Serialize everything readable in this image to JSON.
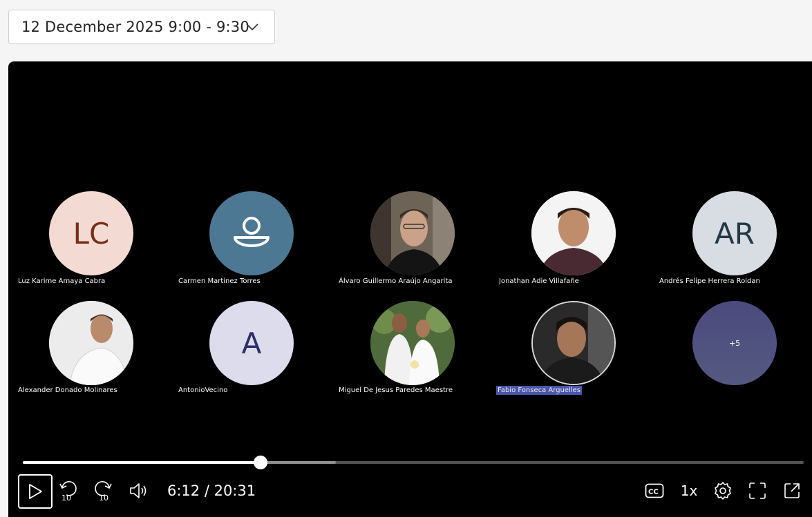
{
  "meeting_select": {
    "label": "12 December 2025 9:00 - 9:30",
    "icon": "chevron-down-icon"
  },
  "participants": [
    {
      "name": "Luz Karime Amaya Cabra",
      "type": "initials",
      "initials": "LC",
      "bg": "#f3dbd3",
      "fg": "#7a2f16"
    },
    {
      "name": "Carmen Martinez Torres",
      "type": "icon",
      "icon": "person-icon",
      "bg": "#4c7894",
      "fg": "#ffffff"
    },
    {
      "name": "Álvaro Guillermo Araújo Angarita",
      "type": "photo",
      "bg": "#5d5348"
    },
    {
      "name": "Jonathan Adie Villafañe",
      "type": "photo",
      "bg": "#f2f2f2"
    },
    {
      "name": "Andrés Felipe Herrera Roldan",
      "type": "initials",
      "initials": "AR",
      "bg": "#d7dde2",
      "fg": "#24384a"
    },
    {
      "name": "Alexander Donado Molinares",
      "type": "photo",
      "bg": "#efefef"
    },
    {
      "name": "AntonioVecino",
      "type": "initials",
      "initials": "A",
      "bg": "#dcdcec",
      "fg": "#2c2e6e"
    },
    {
      "name": "Miguel De Jesus Paredes Maestre",
      "type": "photo",
      "bg": "#4e6a3b"
    },
    {
      "name": "Fabio Fonseca Arguelles",
      "type": "photo",
      "bg": "#2b2b2b",
      "highlight": true
    },
    {
      "name": "",
      "type": "overflow",
      "count_label": "+5",
      "bg": "#4f5180"
    }
  ],
  "controls": {
    "time_display": "6:12 / 20:31",
    "speed_label": "1x",
    "skip_back_label": "10",
    "skip_forward_label": "10"
  },
  "progress": {
    "played_fraction": 0.304,
    "buffered_fraction": 0.401
  },
  "colors": {
    "player_bg": "#000000",
    "highlight": "#4a56a8"
  }
}
